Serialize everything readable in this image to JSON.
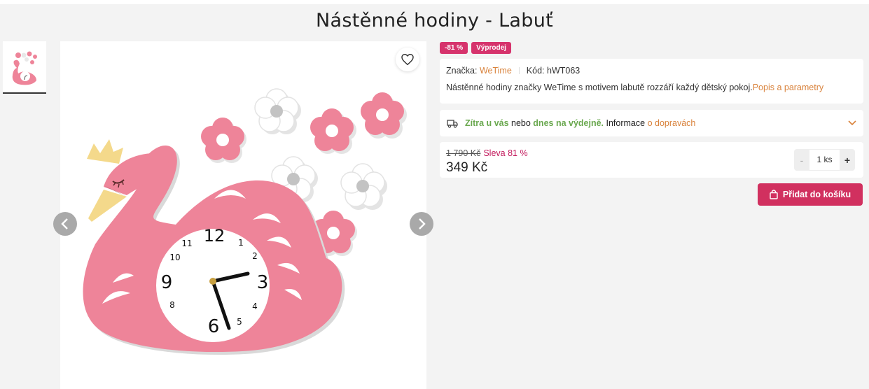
{
  "product": {
    "title": "Nástěnné hodiny - Labuť"
  },
  "badges": [
    "-81 %",
    "Výprodej"
  ],
  "info": {
    "brand_label": "Značka:",
    "brand_value": "WeTime",
    "code_label": "Kód:",
    "code_value": "hWT063",
    "description": "Nástěnné hodiny značky WeTime s motivem labutě rozzáří každý dětský pokoj.",
    "details_link": "Popis a parametry"
  },
  "delivery": {
    "part1": "Zítra u vás",
    "part2": " nebo ",
    "part3": "dnes na výdejně.",
    "part4": " Informace ",
    "link": "o dopravách"
  },
  "price": {
    "old": "1 790 Kč",
    "discount": "Sleva 81 %",
    "current": "349 Kč"
  },
  "quantity": {
    "minus": "-",
    "value": "1 ks",
    "plus": "+"
  },
  "cart": {
    "label": "Přidat do košíku"
  },
  "icons": {
    "wishlist": "heart-icon",
    "prev": "chevron-left-icon",
    "next": "chevron-right-icon",
    "delivery": "truck-icon",
    "expand": "chevron-down-icon",
    "cart": "shopping-bag-icon"
  },
  "clock_numerals": [
    "12",
    "1",
    "2",
    "3",
    "4",
    "5",
    "6",
    "8",
    "9",
    "10"
  ],
  "colors": {
    "badge": "#d6336c",
    "cart_button": "#d1305f",
    "link": "#d9823b",
    "delivery_green": "#6aa84f",
    "discount_text": "#c2185b",
    "swan_pink": "#ee8499"
  }
}
